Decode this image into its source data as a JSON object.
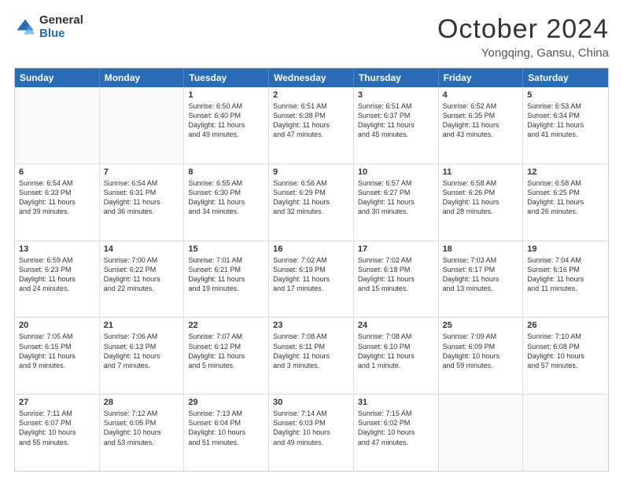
{
  "header": {
    "logo_general": "General",
    "logo_blue": "Blue",
    "title": "October 2024",
    "location": "Yongqing, Gansu, China"
  },
  "weekdays": [
    "Sunday",
    "Monday",
    "Tuesday",
    "Wednesday",
    "Thursday",
    "Friday",
    "Saturday"
  ],
  "weeks": [
    [
      {
        "day": "",
        "empty": true
      },
      {
        "day": "",
        "empty": true
      },
      {
        "day": "1",
        "line1": "Sunrise: 6:50 AM",
        "line2": "Sunset: 6:40 PM",
        "line3": "Daylight: 11 hours",
        "line4": "and 49 minutes."
      },
      {
        "day": "2",
        "line1": "Sunrise: 6:51 AM",
        "line2": "Sunset: 6:38 PM",
        "line3": "Daylight: 11 hours",
        "line4": "and 47 minutes."
      },
      {
        "day": "3",
        "line1": "Sunrise: 6:51 AM",
        "line2": "Sunset: 6:37 PM",
        "line3": "Daylight: 11 hours",
        "line4": "and 45 minutes."
      },
      {
        "day": "4",
        "line1": "Sunrise: 6:52 AM",
        "line2": "Sunset: 6:35 PM",
        "line3": "Daylight: 11 hours",
        "line4": "and 43 minutes."
      },
      {
        "day": "5",
        "line1": "Sunrise: 6:53 AM",
        "line2": "Sunset: 6:34 PM",
        "line3": "Daylight: 11 hours",
        "line4": "and 41 minutes."
      }
    ],
    [
      {
        "day": "6",
        "line1": "Sunrise: 6:54 AM",
        "line2": "Sunset: 6:33 PM",
        "line3": "Daylight: 11 hours",
        "line4": "and 39 minutes."
      },
      {
        "day": "7",
        "line1": "Sunrise: 6:54 AM",
        "line2": "Sunset: 6:31 PM",
        "line3": "Daylight: 11 hours",
        "line4": "and 36 minutes."
      },
      {
        "day": "8",
        "line1": "Sunrise: 6:55 AM",
        "line2": "Sunset: 6:30 PM",
        "line3": "Daylight: 11 hours",
        "line4": "and 34 minutes."
      },
      {
        "day": "9",
        "line1": "Sunrise: 6:56 AM",
        "line2": "Sunset: 6:29 PM",
        "line3": "Daylight: 11 hours",
        "line4": "and 32 minutes."
      },
      {
        "day": "10",
        "line1": "Sunrise: 6:57 AM",
        "line2": "Sunset: 6:27 PM",
        "line3": "Daylight: 11 hours",
        "line4": "and 30 minutes."
      },
      {
        "day": "11",
        "line1": "Sunrise: 6:58 AM",
        "line2": "Sunset: 6:26 PM",
        "line3": "Daylight: 11 hours",
        "line4": "and 28 minutes."
      },
      {
        "day": "12",
        "line1": "Sunrise: 6:58 AM",
        "line2": "Sunset: 6:25 PM",
        "line3": "Daylight: 11 hours",
        "line4": "and 26 minutes."
      }
    ],
    [
      {
        "day": "13",
        "line1": "Sunrise: 6:59 AM",
        "line2": "Sunset: 6:23 PM",
        "line3": "Daylight: 11 hours",
        "line4": "and 24 minutes."
      },
      {
        "day": "14",
        "line1": "Sunrise: 7:00 AM",
        "line2": "Sunset: 6:22 PM",
        "line3": "Daylight: 11 hours",
        "line4": "and 22 minutes."
      },
      {
        "day": "15",
        "line1": "Sunrise: 7:01 AM",
        "line2": "Sunset: 6:21 PM",
        "line3": "Daylight: 11 hours",
        "line4": "and 19 minutes."
      },
      {
        "day": "16",
        "line1": "Sunrise: 7:02 AM",
        "line2": "Sunset: 6:19 PM",
        "line3": "Daylight: 11 hours",
        "line4": "and 17 minutes."
      },
      {
        "day": "17",
        "line1": "Sunrise: 7:02 AM",
        "line2": "Sunset: 6:18 PM",
        "line3": "Daylight: 11 hours",
        "line4": "and 15 minutes."
      },
      {
        "day": "18",
        "line1": "Sunrise: 7:03 AM",
        "line2": "Sunset: 6:17 PM",
        "line3": "Daylight: 11 hours",
        "line4": "and 13 minutes."
      },
      {
        "day": "19",
        "line1": "Sunrise: 7:04 AM",
        "line2": "Sunset: 6:16 PM",
        "line3": "Daylight: 11 hours",
        "line4": "and 11 minutes."
      }
    ],
    [
      {
        "day": "20",
        "line1": "Sunrise: 7:05 AM",
        "line2": "Sunset: 6:15 PM",
        "line3": "Daylight: 11 hours",
        "line4": "and 9 minutes."
      },
      {
        "day": "21",
        "line1": "Sunrise: 7:06 AM",
        "line2": "Sunset: 6:13 PM",
        "line3": "Daylight: 11 hours",
        "line4": "and 7 minutes."
      },
      {
        "day": "22",
        "line1": "Sunrise: 7:07 AM",
        "line2": "Sunset: 6:12 PM",
        "line3": "Daylight: 11 hours",
        "line4": "and 5 minutes."
      },
      {
        "day": "23",
        "line1": "Sunrise: 7:08 AM",
        "line2": "Sunset: 6:11 PM",
        "line3": "Daylight: 11 hours",
        "line4": "and 3 minutes."
      },
      {
        "day": "24",
        "line1": "Sunrise: 7:08 AM",
        "line2": "Sunset: 6:10 PM",
        "line3": "Daylight: 11 hours",
        "line4": "and 1 minute."
      },
      {
        "day": "25",
        "line1": "Sunrise: 7:09 AM",
        "line2": "Sunset: 6:09 PM",
        "line3": "Daylight: 10 hours",
        "line4": "and 59 minutes."
      },
      {
        "day": "26",
        "line1": "Sunrise: 7:10 AM",
        "line2": "Sunset: 6:08 PM",
        "line3": "Daylight: 10 hours",
        "line4": "and 57 minutes."
      }
    ],
    [
      {
        "day": "27",
        "line1": "Sunrise: 7:11 AM",
        "line2": "Sunset: 6:07 PM",
        "line3": "Daylight: 10 hours",
        "line4": "and 55 minutes."
      },
      {
        "day": "28",
        "line1": "Sunrise: 7:12 AM",
        "line2": "Sunset: 6:05 PM",
        "line3": "Daylight: 10 hours",
        "line4": "and 53 minutes."
      },
      {
        "day": "29",
        "line1": "Sunrise: 7:13 AM",
        "line2": "Sunset: 6:04 PM",
        "line3": "Daylight: 10 hours",
        "line4": "and 51 minutes."
      },
      {
        "day": "30",
        "line1": "Sunrise: 7:14 AM",
        "line2": "Sunset: 6:03 PM",
        "line3": "Daylight: 10 hours",
        "line4": "and 49 minutes."
      },
      {
        "day": "31",
        "line1": "Sunrise: 7:15 AM",
        "line2": "Sunset: 6:02 PM",
        "line3": "Daylight: 10 hours",
        "line4": "and 47 minutes."
      },
      {
        "day": "",
        "empty": true
      },
      {
        "day": "",
        "empty": true
      }
    ]
  ]
}
